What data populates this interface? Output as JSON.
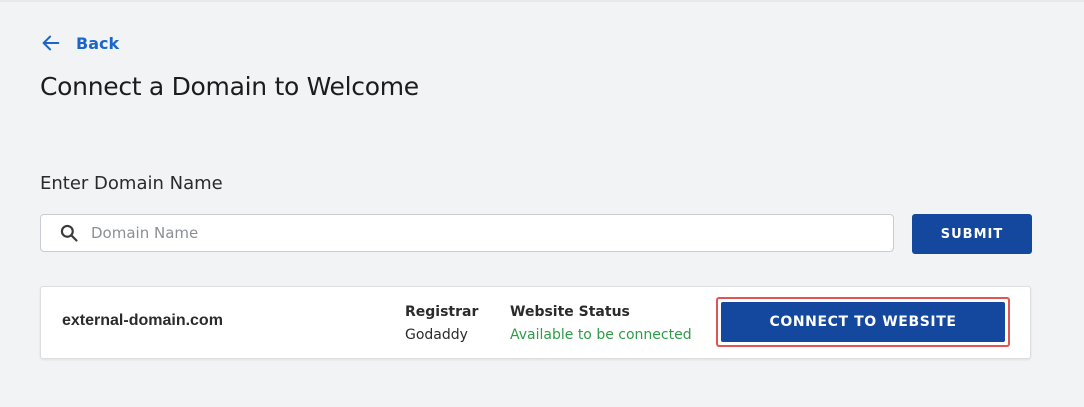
{
  "nav": {
    "back_label": "Back"
  },
  "page": {
    "title": "Connect a Domain to  Welcome"
  },
  "domain_form": {
    "section_label": "Enter Domain Name",
    "search_placeholder": "Domain Name",
    "search_value": "",
    "submit_label": "SUBMIT"
  },
  "domain_card": {
    "domain": "external-domain.com",
    "registrar_label": "Registrar",
    "registrar_value": "Godaddy",
    "status_label": "Website Status",
    "status_value": "Available to be connected",
    "connect_label": "CONNECT TO WEBSITE"
  },
  "colors": {
    "accent": "#14479e",
    "link": "#1a66c9",
    "status_ok": "#2e9c47",
    "highlight": "#e25454",
    "background": "#f2f3f5"
  },
  "icons": [
    "arrow-left-icon",
    "search-icon"
  ]
}
